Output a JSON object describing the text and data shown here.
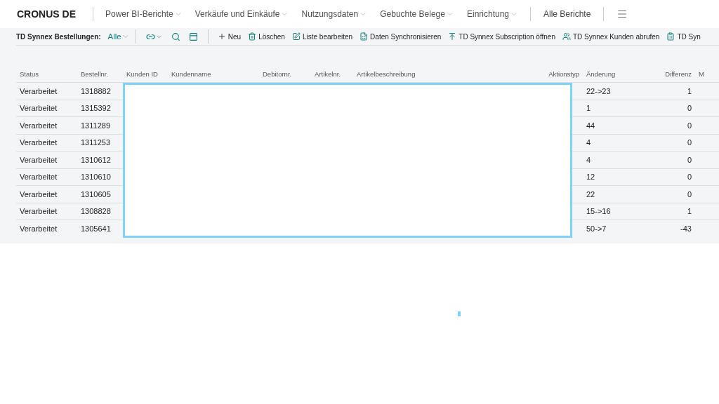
{
  "nav": {
    "title": "CRONUS DE",
    "items": [
      {
        "label": "Power BI-Berichte",
        "kind": "menu"
      },
      {
        "label": "Verkäufe und Einkäufe",
        "kind": "menu"
      },
      {
        "label": "Nutzungsdaten",
        "kind": "menu"
      },
      {
        "label": "Gebuchte Belege",
        "kind": "menu"
      },
      {
        "label": "Einrichtung",
        "kind": "menu"
      },
      {
        "label": "Alle Berichte",
        "kind": "link"
      }
    ]
  },
  "toolbar": {
    "caption": "TD Synnex Bestellungen:",
    "filter": "Alle",
    "actions": [
      {
        "label": "Neu"
      },
      {
        "label": "Löschen"
      },
      {
        "label": "Liste bearbeiten"
      },
      {
        "label": "Daten Synchronisieren"
      },
      {
        "label": "TD Synnex Subscription öffnen"
      },
      {
        "label": "TD Synnex Kunden abrufen"
      },
      {
        "label": "TD Syn"
      }
    ]
  },
  "table": {
    "columns": [
      "Status",
      "Bestellnr.",
      "Kunden ID",
      "Kundenname",
      "Debitornr.",
      "Artikelnr.",
      "Artikelbeschreibung",
      "Aktionstyp",
      "Änderung",
      "Differenz",
      "M"
    ],
    "rows": [
      [
        "Verarbeitet",
        "1318882",
        "22->23",
        "1"
      ],
      [
        "Verarbeitet",
        "1315392",
        "1",
        "0"
      ],
      [
        "Verarbeitet",
        "1311289",
        "44",
        "0"
      ],
      [
        "Verarbeitet",
        "1311253",
        "4",
        "0"
      ],
      [
        "Verarbeitet",
        "1310612",
        "4",
        "0"
      ],
      [
        "Verarbeitet",
        "1310610",
        "12",
        "0"
      ],
      [
        "Verarbeitet",
        "1310605",
        "22",
        "0"
      ],
      [
        "Verarbeitet",
        "1308828",
        "15->16",
        "1"
      ],
      [
        "Verarbeitet",
        "1305641",
        "50->7",
        "-43"
      ]
    ]
  }
}
